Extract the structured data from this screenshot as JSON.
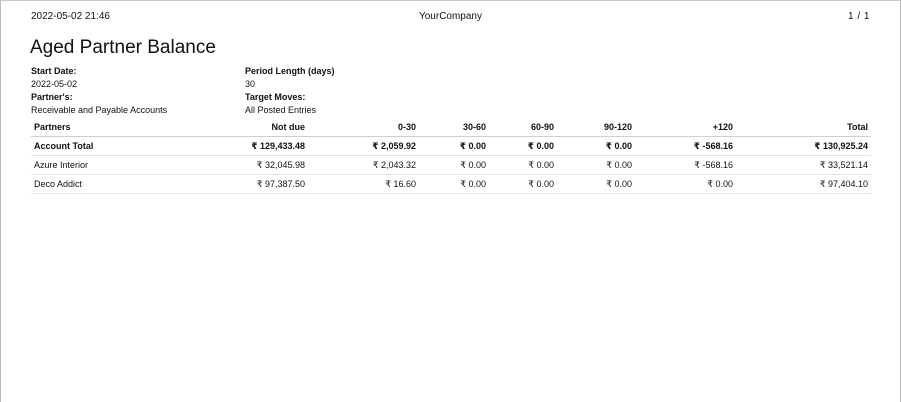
{
  "header": {
    "datetime": "2022-05-02 21:46",
    "company": "YourCompany",
    "page_info": "1 / 1"
  },
  "report": {
    "title": "Aged Partner Balance",
    "start_date_label": "Start Date:",
    "start_date_value": "2022-05-02",
    "partners_label": "Partner's:",
    "partners_value": "Receivable and Payable Accounts",
    "period_label": "Period Length (days)",
    "period_value": "30",
    "target_label": "Target Moves:",
    "target_value": "All Posted Entries"
  },
  "table": {
    "columns": [
      "Partners",
      "Not due",
      "0-30",
      "30-60",
      "60-90",
      "90-120",
      "+120",
      "Total"
    ],
    "rows": [
      {
        "kind": "total",
        "name": "Account Total",
        "values": [
          "₹ 129,433.48",
          "₹ 2,059.92",
          "₹ 0.00",
          "₹ 0.00",
          "₹ 0.00",
          "₹ -568.16",
          "₹ 130,925.24"
        ]
      },
      {
        "kind": "partner",
        "name": "Azure Interior",
        "values": [
          "₹ 32,045.98",
          "₹ 2,043.32",
          "₹ 0.00",
          "₹ 0.00",
          "₹ 0.00",
          "₹ -568.16",
          "₹ 33,521.14"
        ]
      },
      {
        "kind": "partner",
        "name": "Deco Addict",
        "values": [
          "₹ 97,387.50",
          "₹ 16.60",
          "₹ 0.00",
          "₹ 0.00",
          "₹ 0.00",
          "₹ 0.00",
          "₹ 97,404.10"
        ]
      }
    ]
  }
}
